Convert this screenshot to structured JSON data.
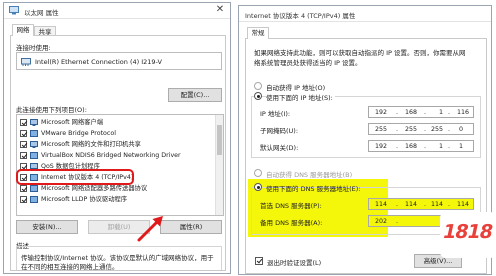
{
  "left_dialog": {
    "title": "以太网 属性",
    "tabs": [
      "网络",
      "共享"
    ],
    "connect_using_label": "连接时使用:",
    "adapter_name": "Intel(R) Ethernet Connection (4) I219-V",
    "configure_button": "配置(C)...",
    "components_label": "此连接使用下列项目(O):",
    "components": [
      "Microsoft 网络客户端",
      "VMware Bridge Protocol",
      "Microsoft 网络的文件和打印机共享",
      "VirtualBox NDIS6 Bridged Networking Driver",
      "QoS 数据包计划程序",
      "Internet 协议版本 4 (TCP/IPv4)",
      "Microsoft 网络适配器多路传送器协议",
      "Microsoft LLDP 协议驱动程序"
    ],
    "install_button": "安装(N)...",
    "uninstall_button": "卸载(U)",
    "properties_button": "属性(R)",
    "description_label": "描述",
    "description_text": [
      "传输控制协议/Internet 协议。该协议是默认的广域网络协议，用于",
      "在不同的相互连接的网络上通信。"
    ]
  },
  "right_dialog": {
    "title": "Internet 协议版本 4 (TCP/IPv4) 属性",
    "tab": "常规",
    "intro": [
      "如果网络支持此功能，则可以获取自动指派的 IP 设置。否则，你需要从网",
      "络系统管理员处获得适当的 IP 设置。"
    ],
    "auto_ip_label": "自动获得 IP 地址(O)",
    "manual_ip_label": "使用下面的 IP 地址(S):",
    "ip_label": "IP 地址(I):",
    "ip_value": [
      "192",
      "168",
      "1",
      "116"
    ],
    "mask_label": "子网掩码(U):",
    "mask_value": [
      "255",
      "255",
      "255",
      "0"
    ],
    "gateway_label": "默认网关(D):",
    "gateway_value": [
      "192",
      "168",
      "1",
      "1"
    ],
    "auto_dns_label": "自动获得 DNS 服务器地址(B)",
    "manual_dns_label": "使用下面的 DNS 服务器地址(E):",
    "preferred_dns_label": "首选 DNS 服务器(P):",
    "preferred_dns_value": [
      "114",
      "114",
      "114",
      "114"
    ],
    "alternate_dns_label": "备用 DNS 服务器(A):",
    "alternate_dns_value": [
      "202",
      "",
      "",
      ""
    ],
    "validate_label": "退出时验证设置(L)",
    "advanced_button": "高级(V)..."
  },
  "watermark": "1818",
  "colors": {
    "highlight": "#f4f70a",
    "red_annotation": "#e0191b",
    "watermark_red": "#e8403a"
  }
}
